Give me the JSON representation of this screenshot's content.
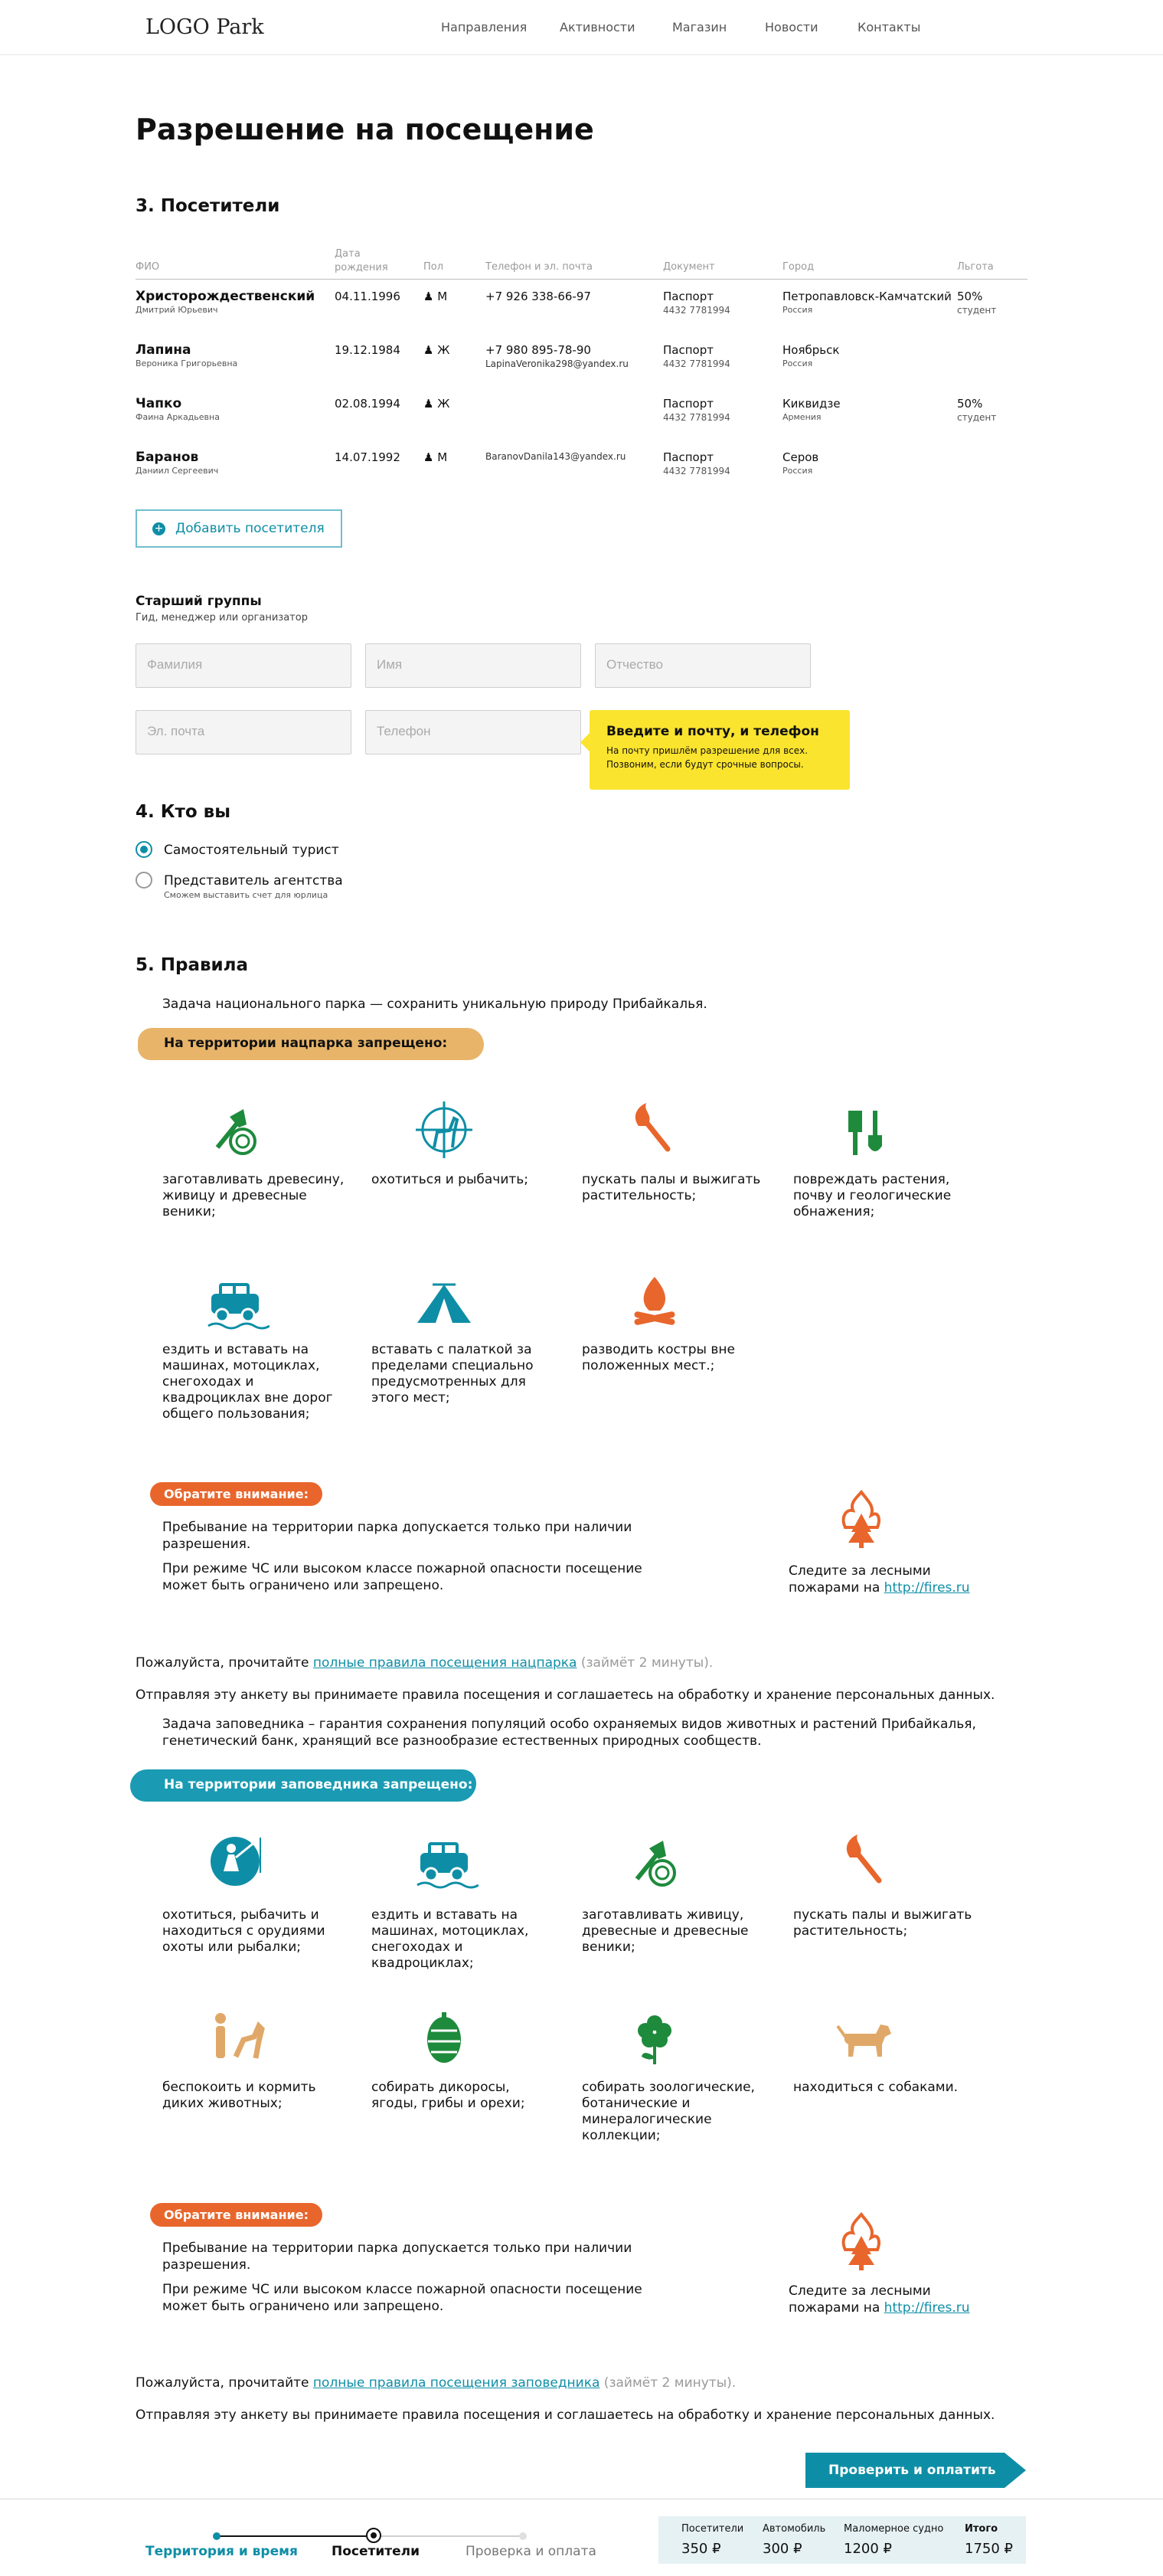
{
  "header": {
    "logo": "LOGO Park",
    "nav": [
      "Направления",
      "Активности",
      "Магазин",
      "Новости",
      "Контакты"
    ]
  },
  "page_title": "Разрешение на посещение",
  "visitors": {
    "heading": "3. Посетители",
    "columns": {
      "name": "ФИО",
      "date": "Дата рождения",
      "sex": "Пол",
      "phone": "Телефон и эл. почта",
      "doc": "Документ",
      "city": "Город",
      "discount": "Льгота"
    },
    "rows": [
      {
        "surname": "Христорождественский",
        "given": "Дмитрий Юрьевич",
        "date": "04.11.1996",
        "sex": "М",
        "phone": "+7 926 338-66-97",
        "email": "",
        "doc": "Паспорт",
        "doc_no": "4432 7781994",
        "city": "Петропавловск-Камчатский",
        "country": "Россия",
        "disc": "50%",
        "disc_sub": "студент"
      },
      {
        "surname": "Лапина",
        "given": "Вероника Григорьевна",
        "date": "19.12.1984",
        "sex": "Ж",
        "phone": "+7 980 895-78-90",
        "email": "LapinaVeronika298@yandex.ru",
        "doc": "Паспорт",
        "doc_no": "4432 7781994",
        "city": "Ноябрьск",
        "country": "Россия",
        "disc": "",
        "disc_sub": ""
      },
      {
        "surname": "Чапко",
        "given": "Фаина Аркадьевна",
        "date": "02.08.1994",
        "sex": "Ж",
        "phone": "",
        "email": "",
        "doc": "Паспорт",
        "doc_no": "4432 7781994",
        "city": "Киквидзе",
        "country": "Армения",
        "disc": "50%",
        "disc_sub": "студент"
      },
      {
        "surname": "Баранов",
        "given": "Даниил Сергеевич",
        "date": "14.07.1992",
        "sex": "М",
        "phone": "",
        "email": "BaranovDanila143@yandex.ru",
        "doc": "Паспорт",
        "doc_no": "4432 7781994",
        "city": "Серов",
        "country": "Россия",
        "disc": "",
        "disc_sub": ""
      }
    ],
    "add_button": "Добавить посетителя"
  },
  "leader": {
    "title": "Старший группы",
    "subtitle": "Гид, менеджер или организатор",
    "surname_ph": "Фамилия",
    "name_ph": "Имя",
    "patronymic_ph": "Отчество",
    "email_ph": "Эл. почта",
    "phone_ph": "Телефон",
    "tip_title": "Введите и почту, и телефон",
    "tip_text": "На почту пришлём разрешение для всех. Позвоним, если будут срочные вопросы."
  },
  "who": {
    "heading": "4. Кто вы",
    "opt1": "Самостоятельный турист",
    "opt2": "Представитель агентства",
    "opt2_sub": "Сможем выставить счет для юрлица"
  },
  "rules": {
    "heading": "5. Правила",
    "park_intro": "Задача национального парка — сохранить уникальную природу Прибайкалья.",
    "park_banner": "На территории нацпарка запрещено:",
    "park_items": [
      {
        "icon": "axe-stump-icon",
        "color": "#1e8a3c",
        "text": "заготавливать древесину, живицу и древесные веники;"
      },
      {
        "icon": "crosshair-deer-icon",
        "color": "#0e8ea6",
        "text": "охотиться и рыбачить;"
      },
      {
        "icon": "match-fire-icon",
        "color": "#e8662c",
        "text": "пускать палы и выжигать растительность;"
      },
      {
        "icon": "shovel-icon",
        "color": "#1e8a3c",
        "text": "повреждать растения, почву и геологические обнажения;"
      },
      {
        "icon": "car-icon",
        "color": "#0e8ea6",
        "text": "ездить и вставать на машинах, мотоциклах, снегоходах и квадроциклах вне дорог общего пользования;"
      },
      {
        "icon": "tent-icon",
        "color": "#0e8ea6",
        "text": "вставать с палаткой за пределами специально предусмотренных для этого мест;"
      },
      {
        "icon": "campfire-icon",
        "color": "#e8662c",
        "text": "разводить костры вне положенных мест.;"
      }
    ],
    "attention": "Обратите внимание:",
    "note1": "Пребывание на территории парка допускается только при наличии разрешения.",
    "note2": "При режиме ЧС или высоком классе пожарной опасности посещение может быть ограничено или запрещено.",
    "fires_text": "Следите за лесными пожарами на ",
    "fires_link": "http://fires.ru",
    "read_pre": "Пожалуйста, прочитайте ",
    "read_link_park": "полные правила посещения нацпарка",
    "read_time": " (займёт 2 минуты).",
    "consent": "Отправляя эту анкету вы принимаете правила посещения и соглашаетесь на обработку и хранение персональных данных.",
    "res_intro": "Задача заповедника – гарантия сохранения популяций особо охраняемых видов животных и растений Прибайкалья, генетический банк, хранящий все разнообразие естественных природных сообществ.",
    "res_banner": "На территории заповедника запрещено:",
    "res_items": [
      {
        "icon": "fisherman-icon",
        "color": "#0e8ea6",
        "text": "охотиться, рыбачить и находиться с орудиями охоты или рыбалки;"
      },
      {
        "icon": "car-icon",
        "color": "#0e8ea6",
        "text": "ездить и вставать на машинах, мотоциклах, снегоходах и квадроциклах;"
      },
      {
        "icon": "axe-stump-icon",
        "color": "#1e8a3c",
        "text": "заготавливать живицу, древесные и древесные веники;"
      },
      {
        "icon": "match-fire-icon",
        "color": "#e8662c",
        "text": "пускать палы и выжигать растительность;"
      },
      {
        "icon": "person-animal-icon",
        "color": "#e0a868",
        "text": "беспокоить и кормить диких животных;"
      },
      {
        "icon": "pinecone-icon",
        "color": "#1e8a3c",
        "text": "собирать дикоросы, ягоды, грибы и орехи;"
      },
      {
        "icon": "flower-icon",
        "color": "#1e8a3c",
        "text": "собирать зоологические, ботанические и минералогические коллекции;"
      },
      {
        "icon": "dog-icon",
        "color": "#e0a868",
        "text": "находиться с собаками."
      }
    ],
    "read_link_res": "полные правила посещения заповедника"
  },
  "cta": "Проверить и оплатить",
  "footer": {
    "steps": [
      "Территория и время",
      "Посетители",
      "Проверка и оплата"
    ],
    "summary": [
      {
        "label": "Посетители",
        "value": "350 ₽"
      },
      {
        "label": "Автомобиль",
        "value": "300 ₽"
      },
      {
        "label": "Маломерное судно",
        "value": "1200 ₽"
      },
      {
        "label": "Итого",
        "value": "1750 ₽"
      }
    ]
  }
}
